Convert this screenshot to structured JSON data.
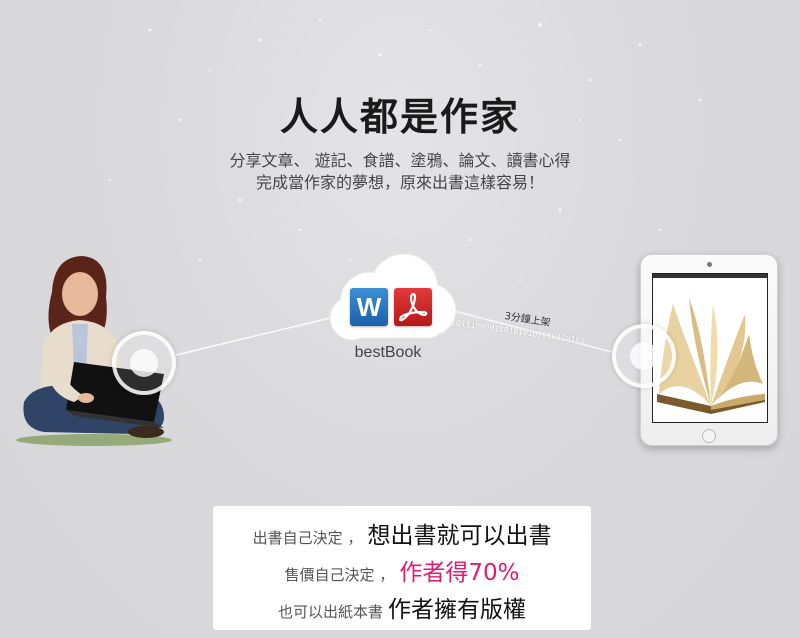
{
  "hero": {
    "title": "人人都是作家",
    "subtitle_line1": "分享文章、 遊記、食譜、塗鴉、論文、讀書心得",
    "subtitle_line2": "完成當作家的夢想，原來出書這樣容易！"
  },
  "diagram": {
    "cloud_label": "bestBook",
    "word_icon_letter": "W",
    "speed_label": "3分鐘上架",
    "binary_text": "1011100001101010101010110100"
  },
  "features": {
    "line1_small": "出書自己決定 ，",
    "line1_big": "想出書就可以出書",
    "line2_small": "售價自己決定 ，",
    "line2_highlight": "作者得70%",
    "line3_small": "也可以出紙本書",
    "line3_big": "作者擁有版權"
  },
  "icons": {
    "word": "word-document-icon",
    "pdf": "pdf-document-icon",
    "cloud": "cloud-icon"
  },
  "colors": {
    "highlight": "#e31a6e",
    "word_blue": "#1d5fa8",
    "pdf_red": "#b51818"
  }
}
